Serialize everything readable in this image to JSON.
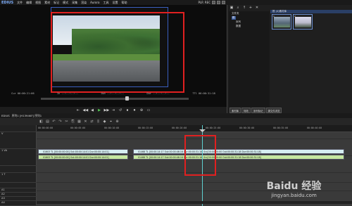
{
  "menubar": {
    "logo": "EDIUS",
    "items": [
      "文件",
      "编辑",
      "视图",
      "素材",
      "标记",
      "模式",
      "采集",
      "渲染",
      "Aurora",
      "工具",
      "设置",
      "帮助"
    ],
    "plr": "PLR",
    "rec": "REC"
  },
  "preview": {
    "timecodes": [
      "Cur 00:00:21:06",
      "In --:--:--:--",
      "Out --:--:--:--",
      "Dur --:--:--:--",
      "TTl 00:00:31:18"
    ]
  },
  "transport": {
    "buttons": [
      "⇤",
      "◀◀",
      "◀",
      "▶",
      "▶▶",
      "⇥",
      "↺",
      "⏹",
      "⏺",
      "⊕",
      "▭"
    ]
  },
  "bin": {
    "title": "根 (4)素材库",
    "tree_items": [
      "文件夹",
      "根",
      "序列",
      "数据"
    ],
    "thumbs": [
      {
        "label": "1"
      },
      {
        "label": "2"
      }
    ],
    "tabs": [
      "素材库",
      "特效",
      "序列标记",
      "源文件浏览"
    ]
  },
  "timeline": {
    "sequence_title": "序列1 [H1394KF] 序列1",
    "track_headers": [
      "",
      "V",
      "1 VA",
      "",
      "1 T",
      "",
      "A1",
      "A2",
      "A3",
      "A4"
    ],
    "ruler_ticks": [
      "00:00:00:00",
      "00:00:05:00",
      "00:00:10:00",
      "00:00:15:00",
      "00:00:20:00",
      "00:00:25:00",
      "00:00:30:00",
      "00:00:35:00",
      "00:00:40:00"
    ],
    "clips": [
      {
        "text": "01603  TL [00:00:00:00] Out:00:00:14:01 Dur:00:00:14:01]",
        "kind": "v"
      },
      {
        "text": "01603  TL [00:00:00:00] Out:00:00:14:01 Dur:00:00:14:01]",
        "kind": "a"
      },
      {
        "text": "01468  TL [00:00:14:17 Out:00:00:46:16 Dur:00:00:31:18]   Src[00:00:00:00 Out:00:00:31:18 Dur:00:00:31:18]",
        "kind": "v"
      },
      {
        "text": "01468  TL [00:00:14:17 Out:00:00:46:16 Dur:00:00:31:18]   Src[00:00:00:00 Out:00:00:31:18 Dur:00:00:31:18]",
        "kind": "a"
      }
    ]
  },
  "watermark": {
    "line1": "Baidu 经验",
    "line2": "jingyan.baidu.com"
  }
}
